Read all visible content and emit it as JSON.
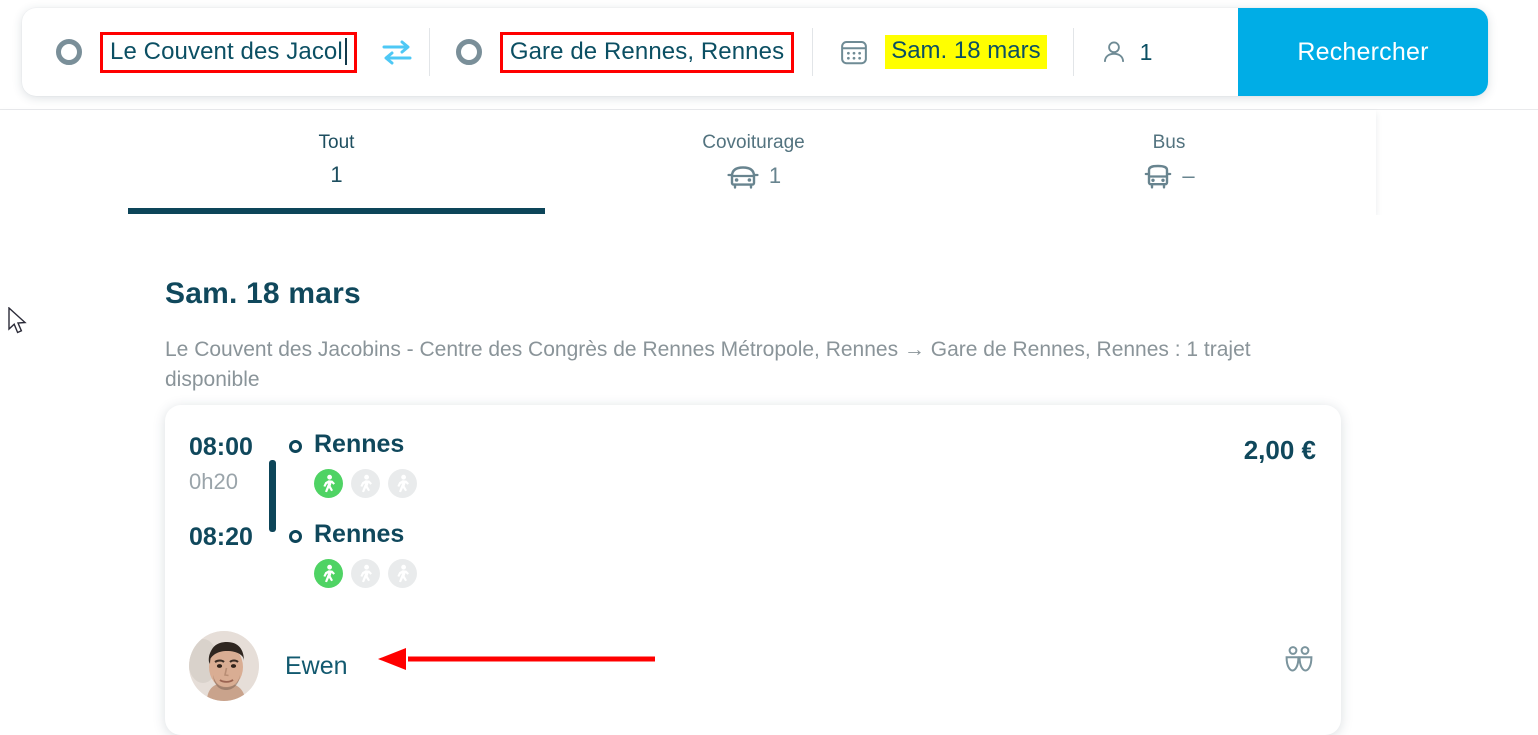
{
  "searchbar": {
    "origin": {
      "icon": "circle-outline-icon",
      "value": "Le Couvent des Jacol",
      "has_caret": true,
      "highlight_color": "#ff0000"
    },
    "swap_icon": "swap-arrows-icon",
    "destination": {
      "icon": "circle-outline-icon",
      "value": "Gare de Rennes, Rennes",
      "highlight_color": "#ff0000"
    },
    "date": {
      "icon": "calendar-icon",
      "value": "Sam. 18 mars",
      "highlight_color": "#ffff00"
    },
    "passengers": {
      "icon": "person-icon",
      "value": "1"
    },
    "submit_label": "Rechercher",
    "submit_color": "#00ade6"
  },
  "tabs": [
    {
      "label": "Tout",
      "value": "1",
      "icon": "",
      "active": true
    },
    {
      "label": "Covoiturage",
      "value": "1",
      "icon": "car-icon",
      "active": false
    },
    {
      "label": "Bus",
      "value": "–",
      "icon": "bus-icon",
      "active": false
    }
  ],
  "results": {
    "date_heading": "Sam. 18 mars",
    "summary": "Le Couvent des Jacobins - Centre des Congrès de Rennes Métropole, Rennes → Gare de Rennes, Rennes : 1 trajet disponible",
    "trip": {
      "departure_time": "08:00",
      "duration": "0h20",
      "departure_stop": "Rennes",
      "arrival_time": "08:20",
      "arrival_stop": "Rennes",
      "price": "2,00 €",
      "driver_name": "Ewen",
      "driver_avatar": "driver-photo",
      "passengers_icon": "two-people-icon",
      "walk_rating_departure": [
        true,
        false,
        false
      ],
      "walk_rating_arrival": [
        true,
        false,
        false
      ]
    }
  },
  "annotations": {
    "arrow_color": "#ff0000",
    "arrow_points_to": "driver-name"
  },
  "theme": {
    "brand_dark_teal": "#0d4559",
    "brand_cyan": "#00ade6",
    "muted_grey": "#8a9499",
    "walk_green": "#4fd364"
  }
}
